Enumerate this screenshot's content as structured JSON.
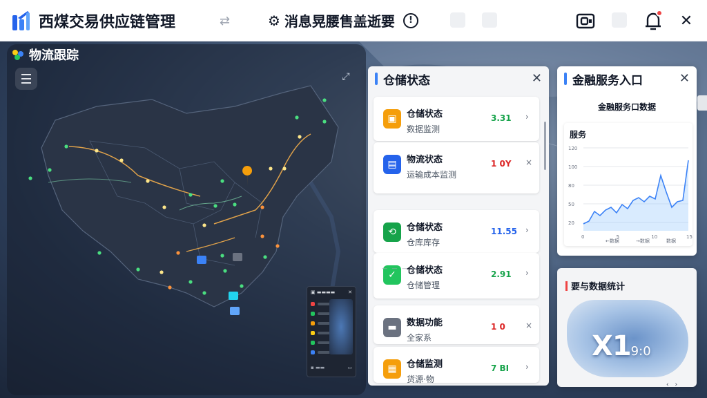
{
  "app": {
    "title": "西煤交易供应链管理",
    "brand_color": "#2563eb"
  },
  "header": {
    "message_title": "消息晃腰售盖逝要",
    "info_label": "!"
  },
  "tracking": {
    "title": "物流跟踪"
  },
  "warehouse": {
    "title": "仓储状态",
    "close": "✕",
    "items": [
      {
        "name": "仓储状态",
        "sub": "数据监测",
        "value": "3.31",
        "value_color": "#16a34a",
        "icon_color": "#f59e0b",
        "icon": "▣",
        "arrow": "›"
      },
      {
        "name": "物流状态",
        "sub": "运输成本监测",
        "value": "1 0Y",
        "value_color": "#dc2626",
        "icon_color": "#2563eb",
        "icon": "▤",
        "arrow": "×"
      },
      {
        "name": "仓储状态",
        "sub": "仓库库存",
        "value": "11.55",
        "value_color": "#2563eb",
        "icon_color": "#16a34a",
        "icon": "⟲",
        "arrow": "›"
      },
      {
        "name": "仓储状态",
        "sub": "仓储管理",
        "value": "2.91",
        "value_color": "#16a34a",
        "icon_color": "#22c55e",
        "icon": "✓",
        "arrow": "›"
      },
      {
        "name": "数据功能",
        "sub": "全家系",
        "value": "1 0",
        "value_color": "#dc2626",
        "icon_color": "#6b7280",
        "icon": "▬",
        "arrow": "×"
      },
      {
        "name": "仓储监测",
        "sub": "货源·物",
        "value": "7 BI",
        "value_color": "#16a34a",
        "icon_color": "#f59e0b",
        "icon": "▦",
        "arrow": "›"
      }
    ],
    "separator": "— — — —"
  },
  "finance": {
    "title": "金融服务入口",
    "close": "✕",
    "subtitle": "金融服务口数据",
    "chart_title": "服务"
  },
  "chart_data": {
    "type": "area",
    "title": "服务",
    "x": [
      1,
      2,
      3,
      4,
      5,
      6,
      7,
      8,
      9,
      10,
      11,
      12,
      13,
      14,
      15,
      16,
      17,
      18,
      19,
      20
    ],
    "series": [
      {
        "name": "",
        "values": [
          10,
          14,
          28,
          22,
          30,
          34,
          26,
          38,
          32,
          44,
          48,
          42,
          50,
          46,
          80,
          56,
          34,
          42,
          44,
          102
        ]
      }
    ],
    "ylim": [
      0,
      120
    ],
    "yticks": [
      "120",
      "100",
      "80",
      "50",
      "20"
    ],
    "xticks": [
      "0",
      "5",
      "10",
      "15"
    ],
    "legend": [
      "←数据",
      "→数据",
      "数据"
    ],
    "grid": true
  },
  "data_panel": {
    "title": "要与数据统计",
    "big_value": "X1",
    "big_suffix": "9:0",
    "footer": "‹ ›"
  },
  "colors": {
    "map_route": "#e0a24a",
    "node_green": "#4ade80",
    "node_orange": "#fb923c",
    "node_yellow": "#fde68a",
    "node_blue": "#60a5fa"
  }
}
